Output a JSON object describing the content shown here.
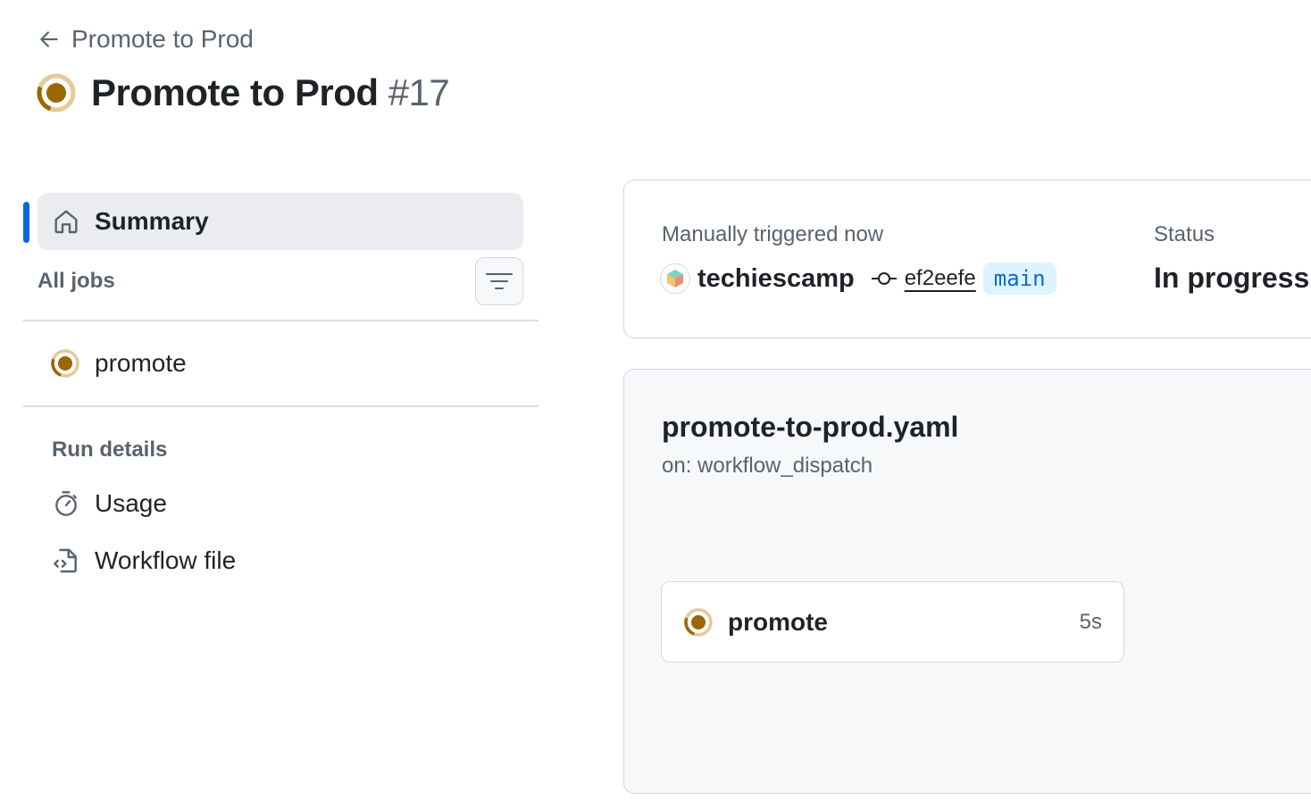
{
  "header": {
    "back_label": "Promote to Prod",
    "title": "Promote to Prod",
    "run_number": "#17",
    "status_icon": "in-progress-ring-icon",
    "status_color": "#9a6700"
  },
  "sidebar": {
    "summary_label": "Summary",
    "all_jobs_label": "All jobs",
    "jobs": [
      {
        "label": "promote",
        "status": "in-progress"
      }
    ],
    "run_details_title": "Run details",
    "details": [
      {
        "label": "Usage",
        "icon": "stopwatch-icon"
      },
      {
        "label": "Workflow file",
        "icon": "file-code-icon"
      }
    ]
  },
  "trigger": {
    "label": "Manually triggered now",
    "actor": "techiescamp",
    "commit_sha": "ef2eefe",
    "branch": "main",
    "status_label": "Status",
    "status_value": "In progress"
  },
  "workflow": {
    "file_name": "promote-to-prod.yaml",
    "trigger": "on: workflow_dispatch",
    "jobs": [
      {
        "name": "promote",
        "duration": "5s"
      }
    ]
  },
  "colors": {
    "accent": "#0969da",
    "in_progress": "#9a6700",
    "branch_bg": "#ddf4ff"
  }
}
